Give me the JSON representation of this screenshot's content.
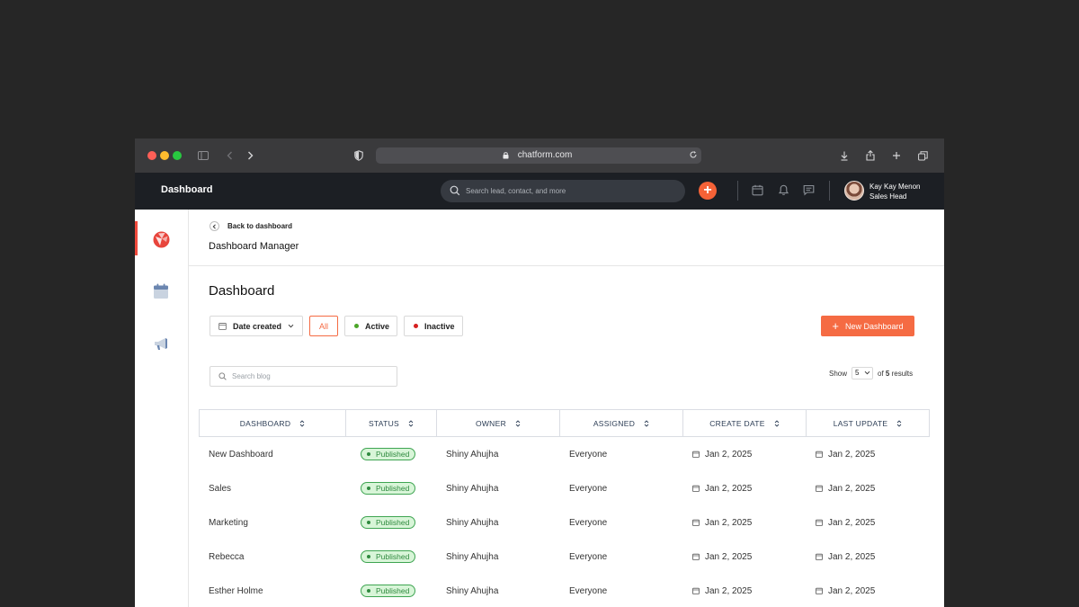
{
  "browser": {
    "url": "chatform.com"
  },
  "header": {
    "title": "Dashboard",
    "search_placeholder": "Search lead, contact, and more",
    "add_label": "+",
    "user": {
      "name": "Kay Kay Menon",
      "role": "Sales Head"
    }
  },
  "sidebar": {
    "items": [
      {
        "icon": "brand-logo-icon",
        "active": true
      },
      {
        "icon": "calendar-icon",
        "active": false
      },
      {
        "icon": "megaphone-icon",
        "active": false
      }
    ]
  },
  "page_header": {
    "back_label": "Back to dashboard",
    "title": "Dashboard Manager"
  },
  "main": {
    "title": "Dashboard",
    "filters": {
      "date": "Date created",
      "all": "All",
      "active": "Active",
      "inactive": "Inactive"
    },
    "new_button": "New Dashboard",
    "search_placeholder": "Search blog",
    "pagination": {
      "show_label": "Show",
      "page_size": "5",
      "of_label": "of",
      "total": "5",
      "results_label": "results"
    }
  },
  "table": {
    "columns": [
      "DASHBOARD",
      "STATUS",
      "OWNER",
      "ASSIGNED",
      "CREATE DATE",
      "LAST UPDATE"
    ],
    "rows": [
      {
        "name": "New Dashboard",
        "status": "Published",
        "owner": "Shiny Ahujha",
        "assigned": "Everyone",
        "created": "Jan 2, 2025",
        "updated": "Jan 2, 2025"
      },
      {
        "name": "Sales",
        "status": "Published",
        "owner": "Shiny Ahujha",
        "assigned": "Everyone",
        "created": "Jan 2, 2025",
        "updated": "Jan 2, 2025"
      },
      {
        "name": "Marketing",
        "status": "Published",
        "owner": "Shiny Ahujha",
        "assigned": "Everyone",
        "created": "Jan 2, 2025",
        "updated": "Jan 2, 2025"
      },
      {
        "name": "Rebecca",
        "status": "Published",
        "owner": "Shiny Ahujha",
        "assigned": "Everyone",
        "created": "Jan 2, 2025",
        "updated": "Jan 2, 2025"
      },
      {
        "name": "Esther Holme",
        "status": "Published",
        "owner": "Shiny Ahujha",
        "assigned": "Everyone",
        "created": "Jan 2, 2025",
        "updated": "Jan 2, 2025"
      }
    ]
  },
  "colors": {
    "accent": "#f56b43",
    "header_bg": "#1c1f24",
    "status_published": "#2f8a3f",
    "status_inactive": "#d62020",
    "status_active": "#4ca629"
  }
}
